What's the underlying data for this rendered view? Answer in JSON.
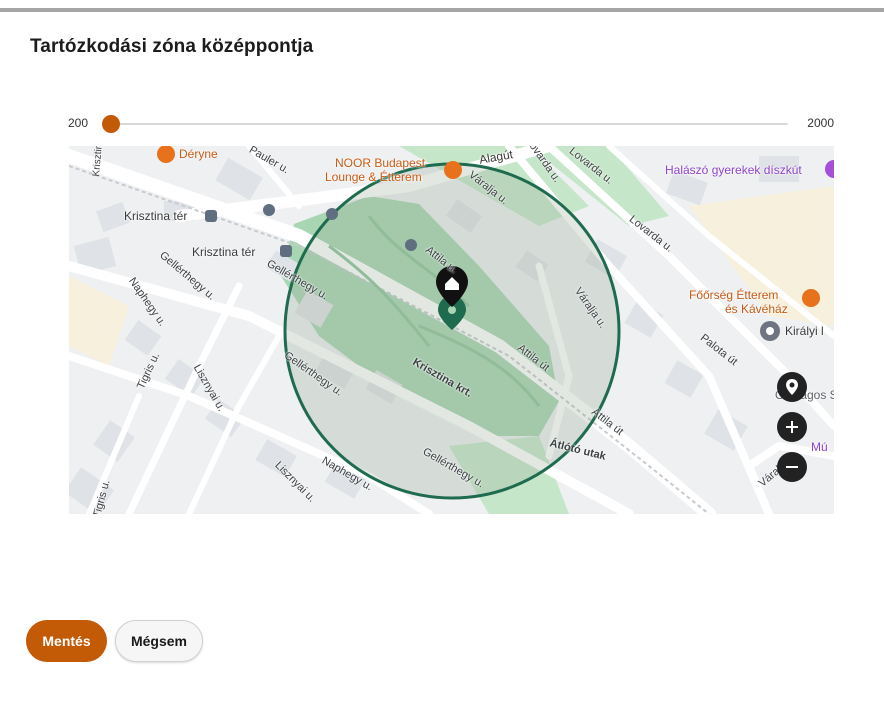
{
  "page": {
    "title": "Tartózkodási zóna középpontja"
  },
  "radius_slider": {
    "min_label": "200",
    "max_label": "2000",
    "value": 200,
    "min": 200,
    "max": 2000
  },
  "map": {
    "labels": {
      "deryne": "Déryne",
      "noor_1": "NOOR Budapest",
      "noor_2": "Lounge & Étterem",
      "alagut": "Alagút",
      "halaszo": "Halászó gyerekek díszkút",
      "krisztina_ter_1": "Krisztina tér",
      "krisztina_ter_2": "Krisztina tér",
      "krisztina_ter_street": "Krisztina tér",
      "pauler": "Pauler u.",
      "attila_u": "Attila u.",
      "varalja_u": "Váralja u.",
      "lovarda_u_1": "Lovarda u.",
      "lovarda_u_2": "Lovarda u.",
      "foorseg_1": "Főőrség Étterem",
      "foorseg_2": "és Kávéház",
      "kiralyi": "Királyi l",
      "palota_ut": "Palota út",
      "orszagos": "Országos S",
      "mu": "Mú",
      "varalja_u2": "Váralja u.",
      "attila_ut": "Attila út",
      "attila_ut2": "Attila út",
      "krisztina_krt": "Krisztina krt.",
      "atlot_utak": "Átlótó utak",
      "gellerthegy_1": "Gellérthegy u.",
      "gellerthegy_2": "Gellérthegy u.",
      "gellerthegy_3": "Gellérthegy u.",
      "gellerthegy_4": "Gellérthegy u.",
      "naphegy_1": "Naphegy u.",
      "naphegy_2": "Naphegy u.",
      "tigris_1": "Tigris u.",
      "tigris_2": "Tigris u.",
      "lisznyai_1": "Lisznyai u.",
      "lisznyai_2": "Lisznyai u.",
      "varalja_bottom": "Váralja u."
    },
    "zone_color": "#1e6b4f",
    "zone_fill": "rgba(150,170,150,0.28)",
    "center_marker_color": "#1e6b4f",
    "home_marker_color": "#111111",
    "icons": {
      "recenter": "location-pin-icon",
      "zoom_in": "plus-icon",
      "zoom_out": "minus-icon"
    }
  },
  "actions": {
    "save": "Mentés",
    "cancel": "Mégsem"
  },
  "colors": {
    "accent": "#c25a06"
  }
}
